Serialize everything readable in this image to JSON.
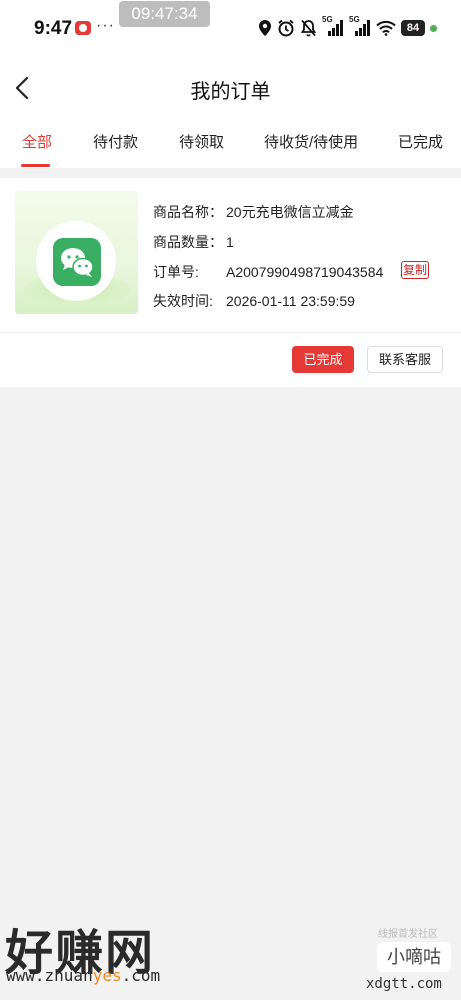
{
  "status_bar": {
    "time": "9:47",
    "dots": "···",
    "clock_pill": "09:47:34",
    "network_1": "5G",
    "network_2": "5G",
    "battery": "84"
  },
  "header": {
    "title": "我的订单"
  },
  "tabs": [
    {
      "label": "全部",
      "active": true
    },
    {
      "label": "待付款",
      "active": false
    },
    {
      "label": "待领取",
      "active": false
    },
    {
      "label": "待收货/待使用",
      "active": false
    },
    {
      "label": "已完成",
      "active": false
    }
  ],
  "order": {
    "product_name_label": "商品名称：",
    "product_name": "20元充电微信立减金",
    "quantity_label": "商品数量：",
    "quantity": "1",
    "order_no_label": "订单号:",
    "order_no": "A2007990498719043584",
    "copy_label": "复制",
    "expire_label": "失效时间:",
    "expire_time": "2026-01-11 23:59:59",
    "status_button": "已完成",
    "service_button": "联系客服"
  },
  "watermark": {
    "brand": "好赚网",
    "url_prefix": "www.zhuan",
    "url_highlight": "yes",
    "url_suffix": ".com",
    "small_top": "线报首发社区",
    "small_brand": "小嘀咕",
    "small_url": "xdgtt.com"
  },
  "colors": {
    "accent": "#e53935",
    "wechat_green": "#3aae62",
    "page_bg": "#f2f2f2"
  }
}
